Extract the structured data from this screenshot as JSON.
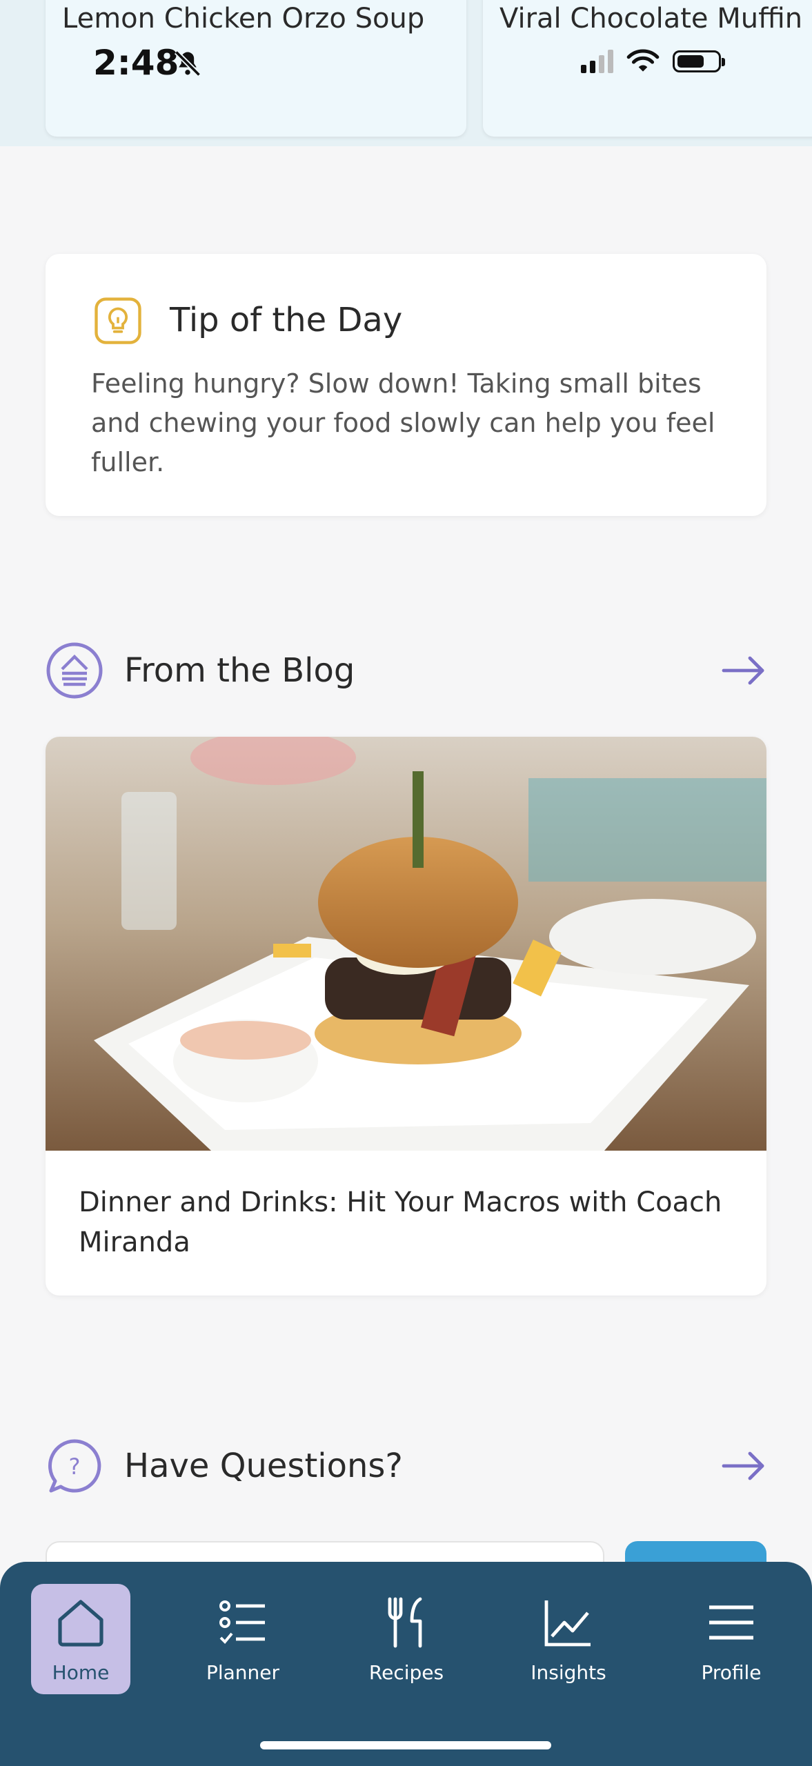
{
  "status_bar": {
    "time": "2:48"
  },
  "recipes": {
    "cards": [
      {
        "title": "Lemon Chicken Orzo Soup"
      },
      {
        "title": "Viral Chocolate Muffin"
      }
    ]
  },
  "tip": {
    "title": "Tip of the Day",
    "body": "Feeling hungry? Slow down! Taking small bites and chewing your food slowly can help you feel fuller.",
    "icon": "lightbulb-icon",
    "icon_color": "#e3b23c"
  },
  "blog": {
    "header": "From the Blog",
    "post_title": "Dinner and Drinks: Hit Your Macros with Coach Miranda",
    "accent": "#8b7fd0"
  },
  "questions": {
    "header": "Have Questions?"
  },
  "nav": {
    "items": [
      {
        "label": "Home",
        "icon": "home-icon",
        "active": true
      },
      {
        "label": "Planner",
        "icon": "checklist-icon",
        "active": false
      },
      {
        "label": "Recipes",
        "icon": "fork-spoon-icon",
        "active": false
      },
      {
        "label": "Insights",
        "icon": "chart-line-icon",
        "active": false
      },
      {
        "label": "Profile",
        "icon": "menu-icon",
        "active": false
      }
    ],
    "background": "#26526f",
    "active_bg": "#c6bfe6"
  }
}
